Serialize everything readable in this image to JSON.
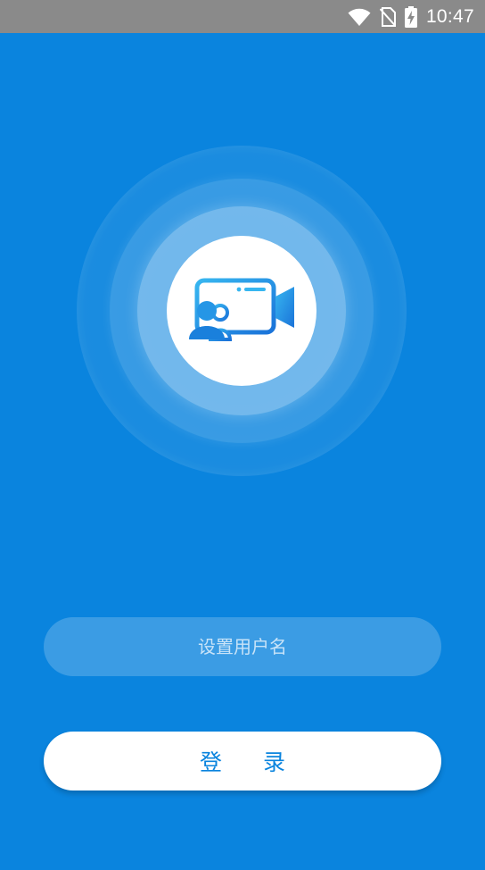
{
  "status_bar": {
    "time": "10:47",
    "icons": [
      "wifi-icon",
      "no-sim-icon",
      "battery-charging-icon"
    ],
    "background": "#8a8a8a"
  },
  "theme": {
    "background": "#0a84de",
    "accent": "#0a84de",
    "logo_gradient_start": "#37b6f0",
    "logo_gradient_end": "#1a73d9"
  },
  "logo": {
    "icon": "video-call-icon"
  },
  "form": {
    "username_placeholder": "设置用户名",
    "username_value": "",
    "login_label": "登录"
  }
}
